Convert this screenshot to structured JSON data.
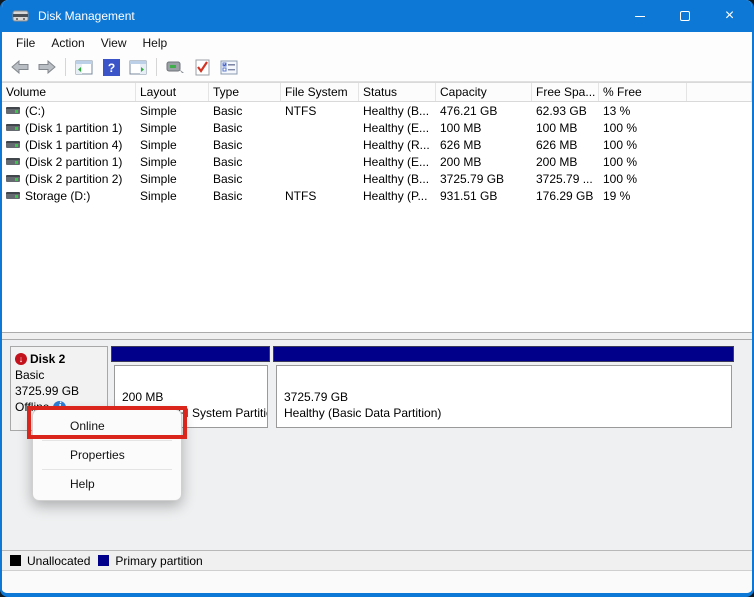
{
  "window": {
    "title": "Disk Management",
    "controls": [
      "minimize",
      "maximize",
      "close"
    ]
  },
  "colors": {
    "titlebar_accent": "#0e78d6",
    "primary_partition": "#00008b",
    "unallocated": "#000000",
    "annotation_red": "#d9251c",
    "info_icon_blue": "#2e7cd6",
    "offline_badge_red": "#c3121c"
  },
  "menubar": {
    "items": [
      "File",
      "Action",
      "View",
      "Help"
    ]
  },
  "toolbar": {
    "icons": [
      "back-arrow",
      "forward-arrow",
      "console-tree",
      "help",
      "action-pane-window",
      "command-prompt",
      "check-document",
      "properties-list"
    ]
  },
  "volume_table": {
    "columns": {
      "volume": "Volume",
      "layout": "Layout",
      "type": "Type",
      "file_system": "File System",
      "status": "Status",
      "capacity": "Capacity",
      "free_space": "Free Spa...",
      "pct_free": "% Free"
    },
    "rows": [
      {
        "volume": "(C:)",
        "layout": "Simple",
        "type": "Basic",
        "file_system": "NTFS",
        "status": "Healthy (B...",
        "capacity": "476.21 GB",
        "free_space": "62.93 GB",
        "pct_free": "13 %"
      },
      {
        "volume": "(Disk 1 partition 1)",
        "layout": "Simple",
        "type": "Basic",
        "file_system": "",
        "status": "Healthy (E...",
        "capacity": "100 MB",
        "free_space": "100 MB",
        "pct_free": "100 %"
      },
      {
        "volume": "(Disk 1 partition 4)",
        "layout": "Simple",
        "type": "Basic",
        "file_system": "",
        "status": "Healthy (R...",
        "capacity": "626 MB",
        "free_space": "626 MB",
        "pct_free": "100 %"
      },
      {
        "volume": "(Disk 2 partition 1)",
        "layout": "Simple",
        "type": "Basic",
        "file_system": "",
        "status": "Healthy (E...",
        "capacity": "200 MB",
        "free_space": "200 MB",
        "pct_free": "100 %"
      },
      {
        "volume": "(Disk 2 partition 2)",
        "layout": "Simple",
        "type": "Basic",
        "file_system": "",
        "status": "Healthy (B...",
        "capacity": "3725.79 GB",
        "free_space": "3725.79 ...",
        "pct_free": "100 %"
      },
      {
        "volume": "Storage (D:)",
        "layout": "Simple",
        "type": "Basic",
        "file_system": "NTFS",
        "status": "Healthy (P...",
        "capacity": "931.51 GB",
        "free_space": "176.29 GB",
        "pct_free": "19 %"
      }
    ]
  },
  "disk_panel": {
    "name": "Disk 2",
    "type": "Basic",
    "size": "3725.99 GB",
    "status": "Offline",
    "partitions": [
      {
        "size": "200 MB",
        "status": "Healthy (EFI System Partitio"
      },
      {
        "size": "3725.79 GB",
        "status": "Healthy (Basic Data Partition)"
      }
    ]
  },
  "context_menu": {
    "highlighted": "Online",
    "items": [
      {
        "label": "Online"
      },
      {
        "label": "Properties"
      },
      {
        "label": "Help"
      }
    ]
  },
  "legend": {
    "items": [
      {
        "label": "Unallocated",
        "color": "#000000"
      },
      {
        "label": "Primary partition",
        "color": "#00008b"
      }
    ]
  }
}
